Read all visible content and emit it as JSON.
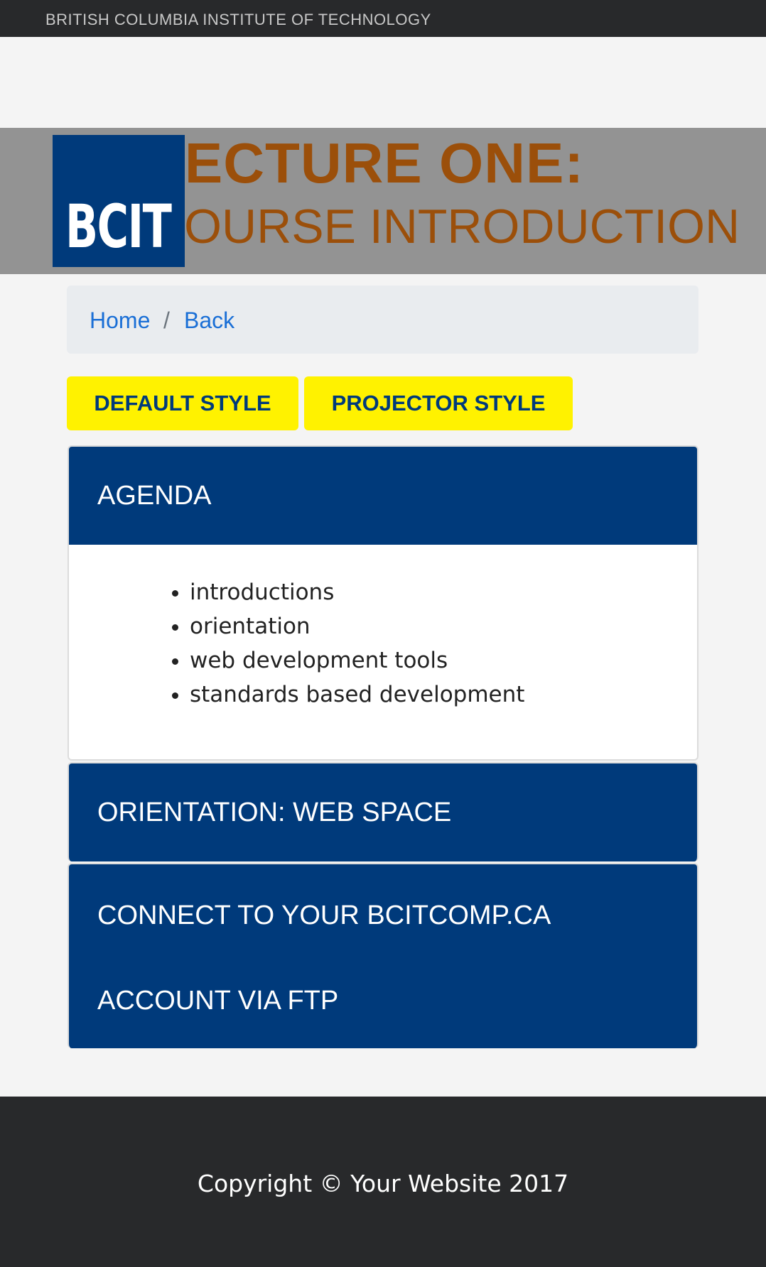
{
  "topbar": {
    "institution": "BRITISH COLUMBIA INSTITUTE OF TECHNOLOGY"
  },
  "banner": {
    "line1": "LECTURE ONE:",
    "line2": "COURSE INTRODUCTION"
  },
  "logo": {
    "text": "BCIT"
  },
  "breadcrumb": {
    "home": "Home",
    "separator": "/",
    "back": "Back"
  },
  "style_buttons": {
    "default_label": "DEFAULT STYLE",
    "projector_label": "PROJECTOR STYLE"
  },
  "cards": {
    "agenda": {
      "title": "AGENDA",
      "items": [
        "introductions",
        "orientation",
        "web development tools",
        "standards based development"
      ]
    },
    "orientation": {
      "title": "ORIENTATION: WEB SPACE"
    },
    "connect": {
      "title_line1": "CONNECT TO YOUR BCITCOMP.CA",
      "title_line2": "ACCOUNT VIA FTP"
    }
  },
  "footer": {
    "copyright": "Copyright © Your Website 2017"
  },
  "colors": {
    "bcit_blue": "#003a7b",
    "button_yellow": "#fff200",
    "banner_text": "#9b4f0a",
    "dark_bar": "#28292b",
    "link_blue": "#1a6fd6"
  }
}
